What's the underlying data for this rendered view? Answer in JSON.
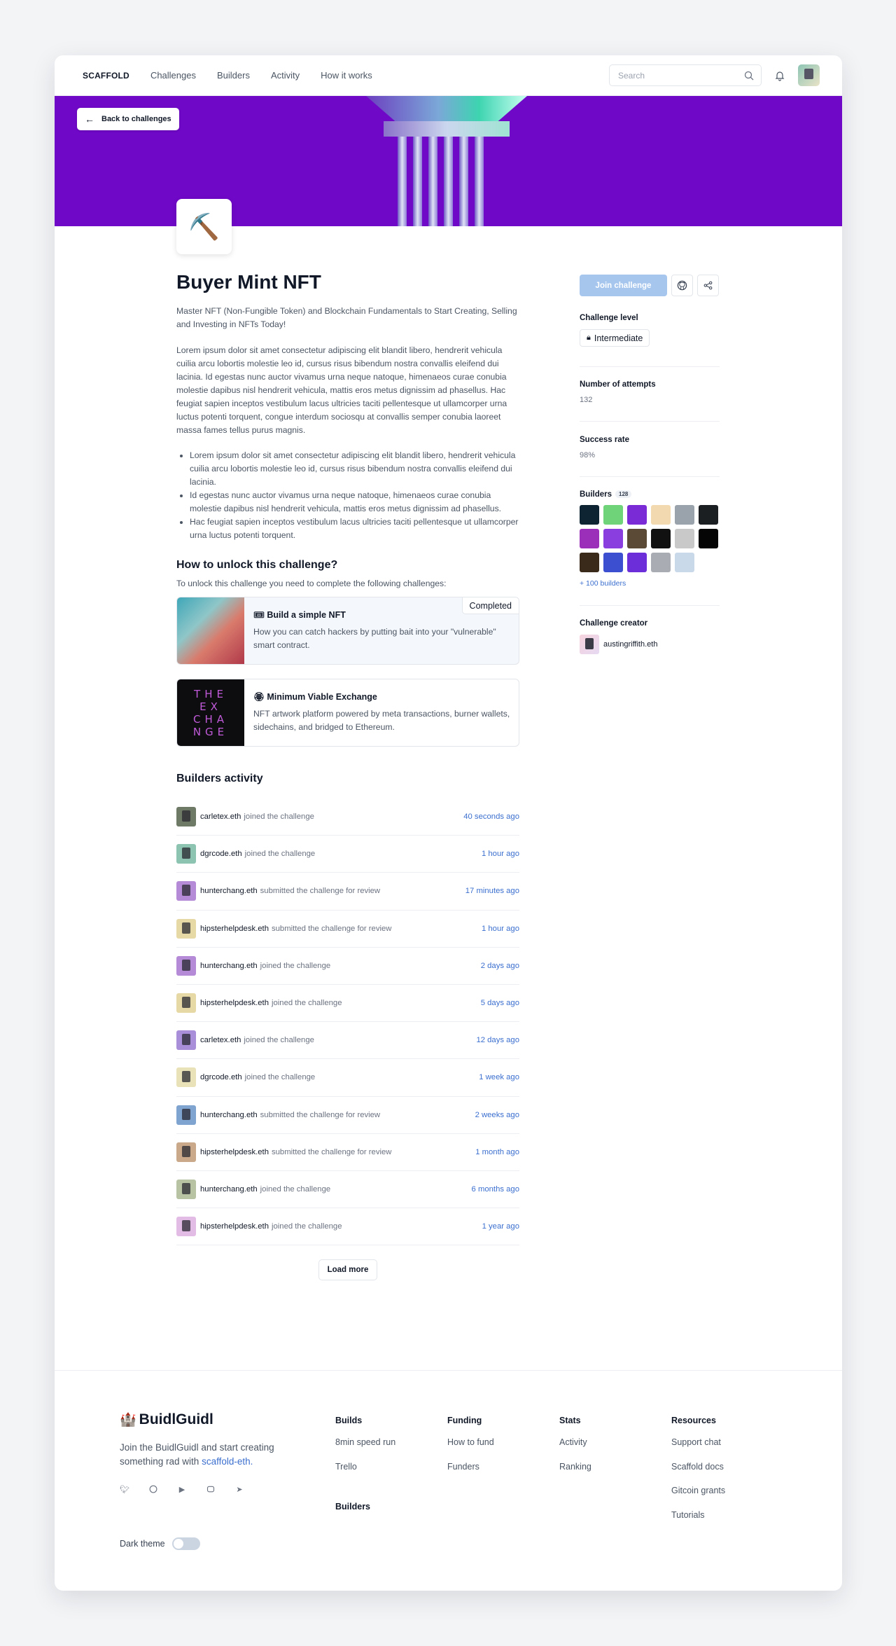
{
  "nav": {
    "logo": "SCAFFOLD",
    "links": [
      "Challenges",
      "Builders",
      "Activity",
      "How it works"
    ],
    "search_placeholder": "Search"
  },
  "banner": {
    "back_label": "Back to challenges",
    "challenge_icon": "⛏️"
  },
  "challenge": {
    "title": "Buyer Mint NFT",
    "lead": "Master NFT (Non-Fungible Token) and Blockchain Fundamentals to Start Creating, Selling and Investing in NFTs Today!",
    "body": "Lorem ipsum dolor sit amet consectetur adipiscing elit blandit libero, hendrerit vehicula cuilia arcu lobortis molestie leo id, cursus risus bibendum nostra convallis eleifend dui lacinia. Id egestas nunc auctor vivamus urna neque natoque, himenaeos curae conubia molestie dapibus nisl hendrerit vehicula, mattis eros metus dignissim ad phasellus. Hac feugiat sapien inceptos vestibulum lacus ultricies taciti pellentesque ut ullamcorper urna luctus potenti torquent, congue interdum sociosqu at convallis semper conubia laoreet massa fames tellus purus magnis.",
    "bullets": [
      "Lorem ipsum dolor sit amet consectetur adipiscing elit blandit libero, hendrerit vehicula cuilia arcu lobortis molestie leo id, cursus risus bibendum nostra convallis eleifend dui lacinia.",
      "Id egestas nunc auctor vivamus urna neque natoque, himenaeos curae conubia molestie dapibus nisl hendrerit vehicula, mattis eros metus dignissim ad phasellus.",
      "Hac feugiat sapien inceptos vestibulum lacus ultricies taciti pellentesque ut ullamcorper urna luctus potenti torquent."
    ]
  },
  "unlock": {
    "heading": "How to unlock this challenge?",
    "subtitle": "To unlock this challenge you need to complete the following challenges:",
    "cards": [
      {
        "title": "🎟 Build a simple NFT",
        "desc": "How you can catch hackers by putting bait into your \"vulnerable\" smart contract.",
        "badge": "Completed"
      },
      {
        "title": "🏵 Minimum Viable Exchange",
        "desc": "NFT artwork platform powered by meta transactions, burner wallets, sidechains, and bridged to Ethereum.",
        "image_text": [
          "THE",
          "EX",
          "CHA",
          "NGE"
        ]
      }
    ]
  },
  "activity": {
    "heading": "Builders activity",
    "rows": [
      {
        "name": "carletex.eth",
        "action": "joined the challenge",
        "time": "40 seconds ago",
        "color": "#6f7a66"
      },
      {
        "name": "dgrcode.eth",
        "action": "joined the challenge",
        "time": "1 hour ago",
        "color": "#8cc3b1"
      },
      {
        "name": "hunterchang.eth",
        "action": "submitted the challenge for review",
        "time": "17 minutes ago",
        "color": "#b58ad6"
      },
      {
        "name": "hipsterhelpdesk.eth",
        "action": "submitted the challenge for review",
        "time": "1 hour ago",
        "color": "#e7d9a6"
      },
      {
        "name": "hunterchang.eth",
        "action": "joined the challenge",
        "time": "2 days ago",
        "color": "#b58ad6"
      },
      {
        "name": "hipsterhelpdesk.eth",
        "action": "joined the challenge",
        "time": "5 days ago",
        "color": "#e7d9a6"
      },
      {
        "name": "carletex.eth",
        "action": "joined the challenge",
        "time": "12 days ago",
        "color": "#a98fd9"
      },
      {
        "name": "dgrcode.eth",
        "action": "joined the challenge",
        "time": "1 week ago",
        "color": "#e9e2b8"
      },
      {
        "name": "hunterchang.eth",
        "action": "submitted the challenge for review",
        "time": "2 weeks ago",
        "color": "#7fa4cf"
      },
      {
        "name": "hipsterhelpdesk.eth",
        "action": "submitted the challenge for review",
        "time": "1 month ago",
        "color": "#c9a98a"
      },
      {
        "name": "hunterchang.eth",
        "action": "joined the challenge",
        "time": "6 months ago",
        "color": "#b7c3a3"
      },
      {
        "name": "hipsterhelpdesk.eth",
        "action": "joined the challenge",
        "time": "1 year ago",
        "color": "#e3bce6"
      }
    ],
    "load_more": "Load more"
  },
  "sidebar": {
    "join_label": "Join challenge",
    "level_label": "Challenge level",
    "level_value": "Intermediate",
    "attempts_label": "Number of attempts",
    "attempts_value": "132",
    "success_label": "Success rate",
    "success_value": "98%",
    "builders_label": "Builders",
    "builders_count": "128",
    "builder_colors": [
      "#0f2433",
      "#6fd37a",
      "#7a2bd6",
      "#f2d9b0",
      "#9aa3ab",
      "#1c1f22",
      "#9b2fb9",
      "#8a3ee0",
      "#5b4a36",
      "#111111",
      "#c9c9c9",
      "#050505",
      "#3a2a1a",
      "#3c4fd0",
      "#6b2ed8",
      "#a9adb3",
      "#c9d9ea"
    ],
    "more_builders": "+ 100 builders",
    "creator_label": "Challenge creator",
    "creator_name": "austingriffith.eth"
  },
  "footer": {
    "brand": "BuidlGuidl",
    "brand_icon": "🏰",
    "tagline": "Join the BuidlGuidl and start creating something rad with",
    "tagline_link": "scaffold-eth.",
    "dark_theme_label": "Dark theme",
    "columns": [
      {
        "title": "Builds",
        "items": [
          "8min speed run",
          "Trello"
        ]
      },
      {
        "title": "Funding",
        "items": [
          "How to fund",
          "Funders"
        ]
      },
      {
        "title": "Stats",
        "items": [
          "Activity",
          "Ranking"
        ]
      },
      {
        "title": "Resources",
        "items": [
          "Support chat",
          "Scaffold docs",
          "Gitcoin grants",
          "Tutorials"
        ]
      }
    ],
    "builders_heading": "Builders"
  }
}
